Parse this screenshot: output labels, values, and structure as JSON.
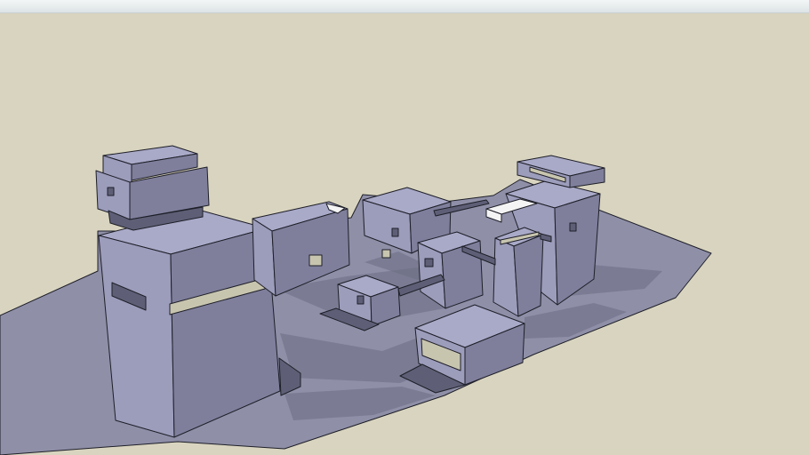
{
  "window": {
    "title": "",
    "toolbar_visible": false
  },
  "scene": {
    "description_visible_text": "",
    "ground_color": "#8f8fa8",
    "background_color": "#d8d4bf",
    "building_color": "#9c9cbb",
    "shadow_color": "#6c6d82",
    "opening_color": "#c8c5af",
    "highlight_color": "#f4f4f4"
  }
}
